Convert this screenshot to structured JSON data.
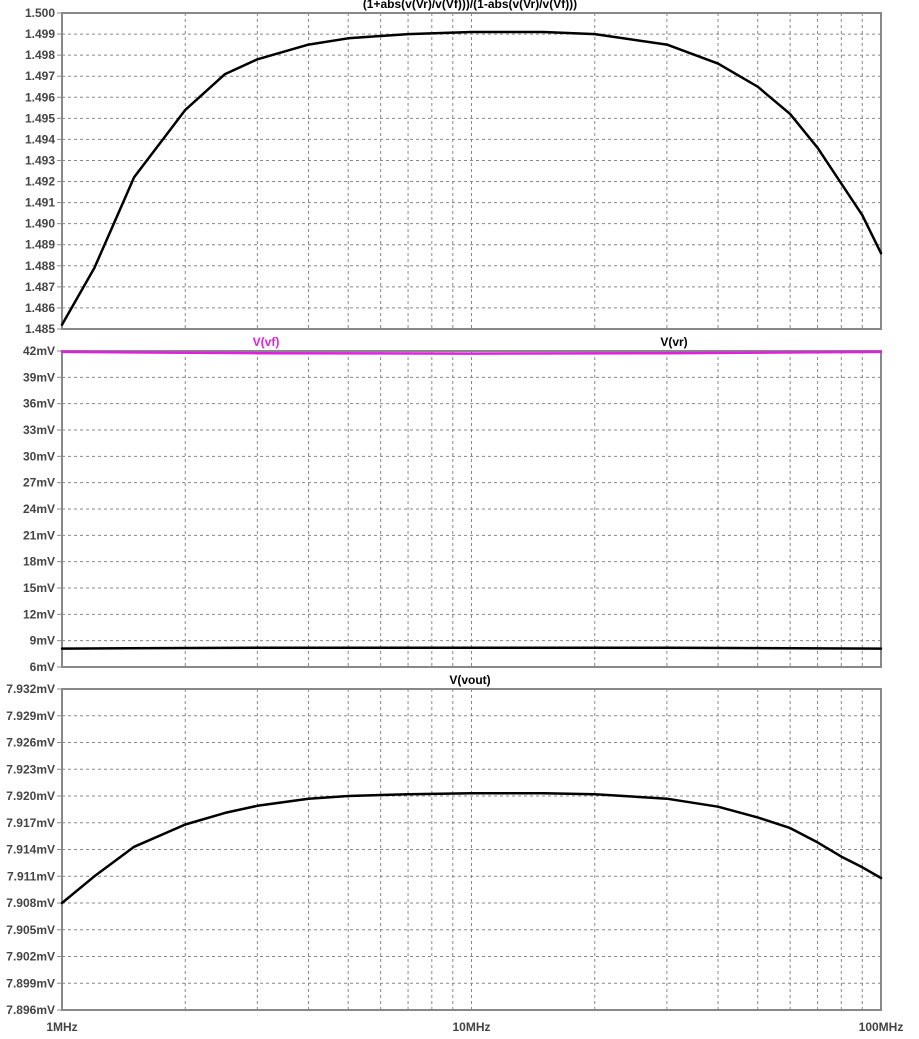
{
  "chart_data": {
    "x_axis": {
      "scale": "log",
      "range_hz": [
        1000000,
        100000000
      ],
      "tick_labels": [
        {
          "value": 1000000,
          "label": "1MHz"
        },
        {
          "value": 10000000,
          "label": "10MHz"
        },
        {
          "value": 100000000,
          "label": "100MHz"
        }
      ]
    },
    "panes": [
      {
        "id": "vswr",
        "type": "line",
        "grid": true,
        "ylim": [
          1.485,
          1.5
        ],
        "y_ticks": [
          "1.485",
          "1.486",
          "1.487",
          "1.488",
          "1.489",
          "1.490",
          "1.491",
          "1.492",
          "1.493",
          "1.494",
          "1.495",
          "1.496",
          "1.497",
          "1.498",
          "1.499",
          "1.500"
        ],
        "series": [
          {
            "name": "(1+abs(v(Vr)/v(Vf)))/(1-abs(v(Vr)/v(Vf)))",
            "color": "#000000",
            "x": [
              1000000,
              1200000,
              1500000,
              2000000,
              2500000,
              3000000,
              4000000,
              5000000,
              7000000,
              10000000,
              15000000,
              20000000,
              30000000,
              40000000,
              50000000,
              60000000,
              70000000,
              80000000,
              90000000,
              100000000
            ],
            "y": [
              1.4852,
              1.4879,
              1.4922,
              1.4954,
              1.4971,
              1.4978,
              1.4985,
              1.4988,
              1.499,
              1.4991,
              1.4991,
              1.499,
              1.4985,
              1.4976,
              1.4965,
              1.4952,
              1.4936,
              1.4919,
              1.4904,
              1.4886
            ]
          }
        ]
      },
      {
        "id": "vf-vr",
        "type": "line",
        "grid": true,
        "ylim": [
          6,
          42
        ],
        "y_unit": "mV",
        "y_ticks": [
          "6mV",
          "9mV",
          "12mV",
          "15mV",
          "18mV",
          "21mV",
          "24mV",
          "27mV",
          "30mV",
          "33mV",
          "36mV",
          "39mV",
          "42mV"
        ],
        "series": [
          {
            "name": "V(vf)",
            "color": "#e020e0",
            "x": [
              1000000,
              3000000,
              10000000,
              30000000,
              100000000
            ],
            "y": [
              41.9,
              41.75,
              41.7,
              41.75,
              41.9
            ]
          },
          {
            "name": "V(vr)",
            "color": "#000000",
            "x": [
              1000000,
              3000000,
              10000000,
              30000000,
              100000000
            ],
            "y": [
              8.1,
              8.2,
              8.2,
              8.2,
              8.1
            ]
          }
        ]
      },
      {
        "id": "vout",
        "type": "line",
        "grid": true,
        "ylim": [
          7.896,
          7.932
        ],
        "y_unit": "mV",
        "y_ticks": [
          "7.896mV",
          "7.899mV",
          "7.902mV",
          "7.905mV",
          "7.908mV",
          "7.911mV",
          "7.914mV",
          "7.917mV",
          "7.920mV",
          "7.923mV",
          "7.926mV",
          "7.929mV",
          "7.932mV"
        ],
        "series": [
          {
            "name": "V(vout)",
            "color": "#000000",
            "x": [
              1000000,
              1200000,
              1500000,
              2000000,
              2500000,
              3000000,
              4000000,
              5000000,
              7000000,
              10000000,
              15000000,
              20000000,
              30000000,
              40000000,
              50000000,
              60000000,
              70000000,
              80000000,
              90000000,
              100000000
            ],
            "y": [
              7.908,
              7.911,
              7.9143,
              7.9168,
              7.9181,
              7.9189,
              7.9197,
              7.92,
              7.9202,
              7.9203,
              7.9203,
              7.9202,
              7.9197,
              7.9188,
              7.9176,
              7.9164,
              7.9148,
              7.9132,
              7.912,
              7.9108
            ]
          }
        ]
      }
    ]
  }
}
